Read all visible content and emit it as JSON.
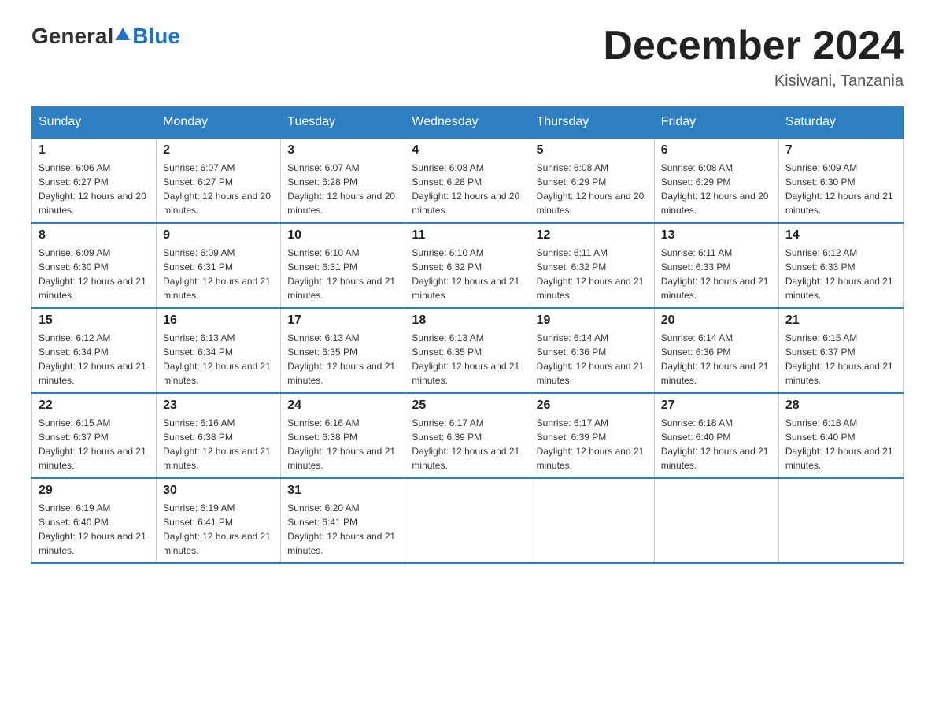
{
  "header": {
    "logo_general": "General",
    "logo_blue": "Blue",
    "title": "December 2024",
    "location": "Kisiwani, Tanzania"
  },
  "calendar": {
    "days_of_week": [
      "Sunday",
      "Monday",
      "Tuesday",
      "Wednesday",
      "Thursday",
      "Friday",
      "Saturday"
    ],
    "weeks": [
      [
        {
          "day": "1",
          "sunrise": "6:06 AM",
          "sunset": "6:27 PM",
          "daylight": "12 hours and 20 minutes."
        },
        {
          "day": "2",
          "sunrise": "6:07 AM",
          "sunset": "6:27 PM",
          "daylight": "12 hours and 20 minutes."
        },
        {
          "day": "3",
          "sunrise": "6:07 AM",
          "sunset": "6:28 PM",
          "daylight": "12 hours and 20 minutes."
        },
        {
          "day": "4",
          "sunrise": "6:08 AM",
          "sunset": "6:28 PM",
          "daylight": "12 hours and 20 minutes."
        },
        {
          "day": "5",
          "sunrise": "6:08 AM",
          "sunset": "6:29 PM",
          "daylight": "12 hours and 20 minutes."
        },
        {
          "day": "6",
          "sunrise": "6:08 AM",
          "sunset": "6:29 PM",
          "daylight": "12 hours and 20 minutes."
        },
        {
          "day": "7",
          "sunrise": "6:09 AM",
          "sunset": "6:30 PM",
          "daylight": "12 hours and 21 minutes."
        }
      ],
      [
        {
          "day": "8",
          "sunrise": "6:09 AM",
          "sunset": "6:30 PM",
          "daylight": "12 hours and 21 minutes."
        },
        {
          "day": "9",
          "sunrise": "6:09 AM",
          "sunset": "6:31 PM",
          "daylight": "12 hours and 21 minutes."
        },
        {
          "day": "10",
          "sunrise": "6:10 AM",
          "sunset": "6:31 PM",
          "daylight": "12 hours and 21 minutes."
        },
        {
          "day": "11",
          "sunrise": "6:10 AM",
          "sunset": "6:32 PM",
          "daylight": "12 hours and 21 minutes."
        },
        {
          "day": "12",
          "sunrise": "6:11 AM",
          "sunset": "6:32 PM",
          "daylight": "12 hours and 21 minutes."
        },
        {
          "day": "13",
          "sunrise": "6:11 AM",
          "sunset": "6:33 PM",
          "daylight": "12 hours and 21 minutes."
        },
        {
          "day": "14",
          "sunrise": "6:12 AM",
          "sunset": "6:33 PM",
          "daylight": "12 hours and 21 minutes."
        }
      ],
      [
        {
          "day": "15",
          "sunrise": "6:12 AM",
          "sunset": "6:34 PM",
          "daylight": "12 hours and 21 minutes."
        },
        {
          "day": "16",
          "sunrise": "6:13 AM",
          "sunset": "6:34 PM",
          "daylight": "12 hours and 21 minutes."
        },
        {
          "day": "17",
          "sunrise": "6:13 AM",
          "sunset": "6:35 PM",
          "daylight": "12 hours and 21 minutes."
        },
        {
          "day": "18",
          "sunrise": "6:13 AM",
          "sunset": "6:35 PM",
          "daylight": "12 hours and 21 minutes."
        },
        {
          "day": "19",
          "sunrise": "6:14 AM",
          "sunset": "6:36 PM",
          "daylight": "12 hours and 21 minutes."
        },
        {
          "day": "20",
          "sunrise": "6:14 AM",
          "sunset": "6:36 PM",
          "daylight": "12 hours and 21 minutes."
        },
        {
          "day": "21",
          "sunrise": "6:15 AM",
          "sunset": "6:37 PM",
          "daylight": "12 hours and 21 minutes."
        }
      ],
      [
        {
          "day": "22",
          "sunrise": "6:15 AM",
          "sunset": "6:37 PM",
          "daylight": "12 hours and 21 minutes."
        },
        {
          "day": "23",
          "sunrise": "6:16 AM",
          "sunset": "6:38 PM",
          "daylight": "12 hours and 21 minutes."
        },
        {
          "day": "24",
          "sunrise": "6:16 AM",
          "sunset": "6:38 PM",
          "daylight": "12 hours and 21 minutes."
        },
        {
          "day": "25",
          "sunrise": "6:17 AM",
          "sunset": "6:39 PM",
          "daylight": "12 hours and 21 minutes."
        },
        {
          "day": "26",
          "sunrise": "6:17 AM",
          "sunset": "6:39 PM",
          "daylight": "12 hours and 21 minutes."
        },
        {
          "day": "27",
          "sunrise": "6:18 AM",
          "sunset": "6:40 PM",
          "daylight": "12 hours and 21 minutes."
        },
        {
          "day": "28",
          "sunrise": "6:18 AM",
          "sunset": "6:40 PM",
          "daylight": "12 hours and 21 minutes."
        }
      ],
      [
        {
          "day": "29",
          "sunrise": "6:19 AM",
          "sunset": "6:40 PM",
          "daylight": "12 hours and 21 minutes."
        },
        {
          "day": "30",
          "sunrise": "6:19 AM",
          "sunset": "6:41 PM",
          "daylight": "12 hours and 21 minutes."
        },
        {
          "day": "31",
          "sunrise": "6:20 AM",
          "sunset": "6:41 PM",
          "daylight": "12 hours and 21 minutes."
        },
        null,
        null,
        null,
        null
      ]
    ]
  }
}
